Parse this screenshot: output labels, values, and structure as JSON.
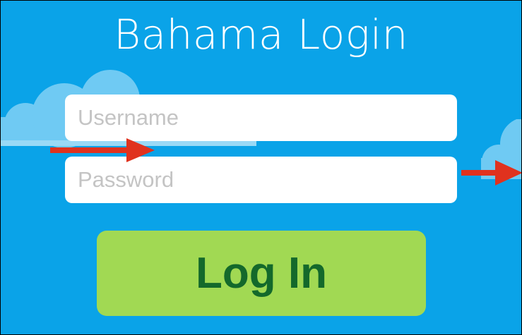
{
  "app": {
    "title": "Bahama Login"
  },
  "form": {
    "username_placeholder": "Username",
    "username_value": "",
    "password_placeholder": "Password",
    "password_value": "",
    "login_label": "Log In"
  },
  "colors": {
    "background": "#0aa3e8",
    "button": "#a1d953",
    "button_text": "#14692b",
    "arrow": "#e0321e",
    "cloud": "#6fcaf3"
  },
  "annotations": {
    "arrows": [
      "red-arrow-icon",
      "red-arrow-icon"
    ]
  }
}
